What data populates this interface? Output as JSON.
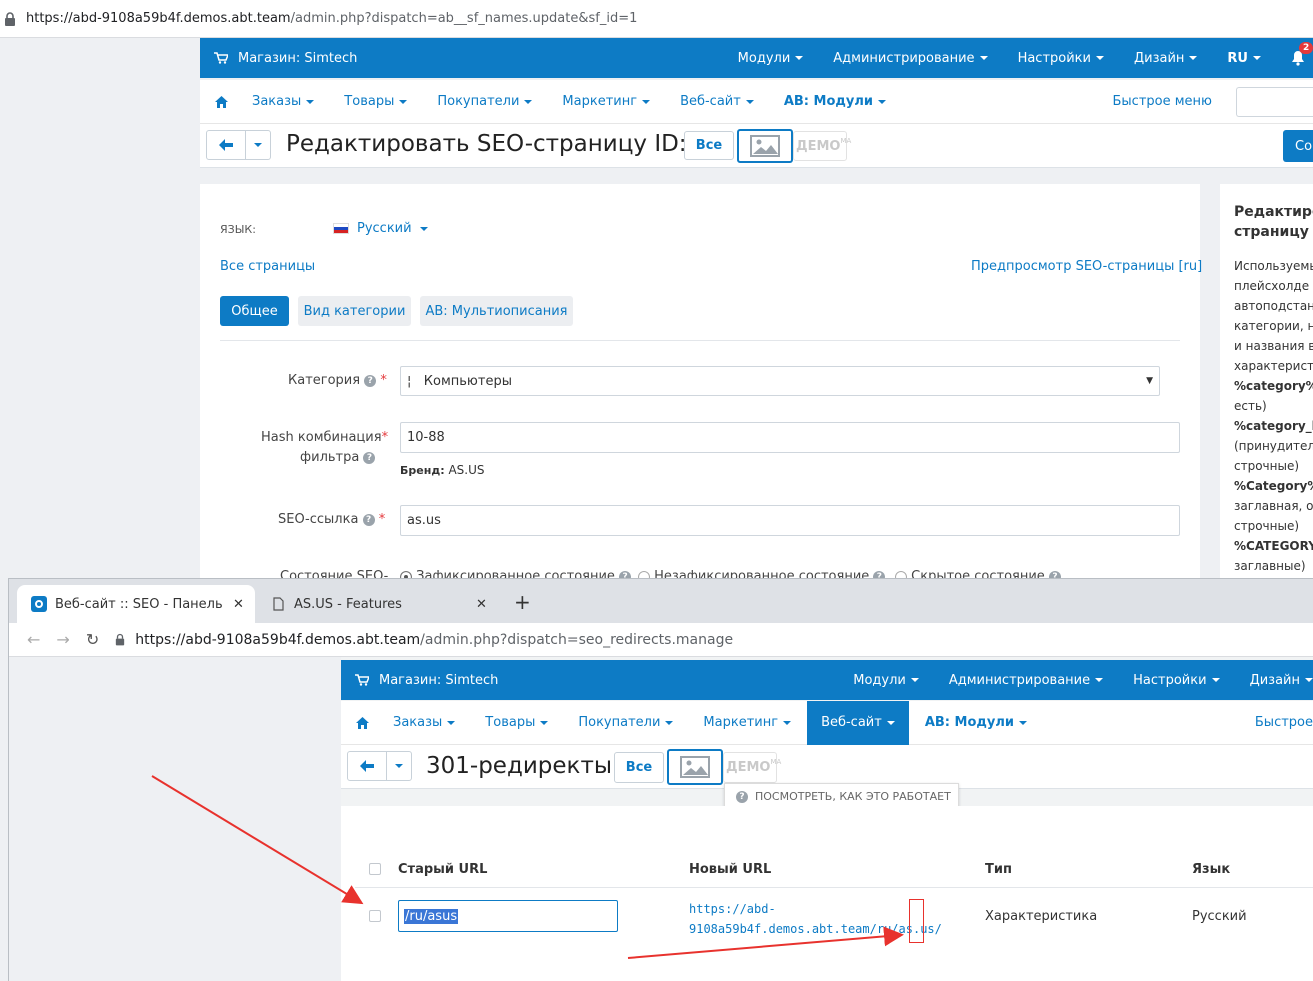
{
  "back_window": {
    "url_host": "https://abd-9108a59b4f.demos.abt.team",
    "url_path": "/admin.php?dispatch=ab__sf_names.update&sf_id=1",
    "store_label": "Магазин: Simtech",
    "top_menu": [
      "Модули",
      "Администрирование",
      "Настройки",
      "Дизайн",
      "RU"
    ],
    "notification_count": "2",
    "secondary_menu": [
      "Заказы",
      "Товары",
      "Покупатели",
      "Маркетинг",
      "Веб-сайт",
      "AB: Модули"
    ],
    "quick_menu": "Быстрое меню",
    "page_title": "Редактировать SEO-страницу ID: 1",
    "all_button": "Все",
    "demo_label": "ДЕМО",
    "demo_suffix": "МА",
    "save_button": "Со",
    "language_label": "ЯЗЫК:",
    "language_value": "Русский",
    "all_pages_link": "Все страницы",
    "preview_link": "Предпросмотр SEO-страницы [ru]",
    "tabs": [
      "Общее",
      "Вид категории",
      "AB: Мультиописания"
    ],
    "category_label": "Категория",
    "category_value": "¦   Компьютеры",
    "hash_label_1": "Hash комбинация",
    "hash_label_2": "фильтра",
    "hash_value": "10-88",
    "brand_key": "Бренд:",
    "brand_value": "AS.US",
    "seo_link_label": "SEO-ссылка",
    "seo_link_value": "as.us",
    "state_label": "Состояние SEO-",
    "state_options": [
      "Зафиксированное состояние",
      "Незафиксированное состояние",
      "Скрытое состояние"
    ],
    "side_title_1": "Редактиро",
    "side_title_2": "страницу I",
    "side_lines": [
      "Используемы",
      "плейсхолде",
      "автоподстан",
      "категории, н",
      "и названия в",
      "характерист"
    ],
    "side_vars": [
      {
        "bold": "%category%",
        "text": " (с"
      },
      {
        "bold": "",
        "text": "есть)"
      },
      {
        "bold": "%category_lov",
        "text": ""
      },
      {
        "bold": "",
        "text": "(принудител"
      },
      {
        "bold": "",
        "text": "строчные)"
      },
      {
        "bold": "%Category%",
        "text": " ("
      },
      {
        "bold": "",
        "text": "заглавная, о"
      },
      {
        "bold": "",
        "text": "строчные)"
      },
      {
        "bold": "%CATEGORY%",
        "text": ""
      },
      {
        "bold": "",
        "text": "заглавные)"
      }
    ]
  },
  "front_window": {
    "tab1_title": "Веб-сайт :: SEO - Панель адм",
    "tab2_title": "AS.US - Features",
    "url_host": "https://abd-9108a59b4f.demos.abt.team",
    "url_path": "/admin.php?dispatch=seo_redirects.manage",
    "store_label": "Магазин: Simtech",
    "top_menu": [
      "Модули",
      "Администрирование",
      "Настройки",
      "Дизайн"
    ],
    "secondary_menu": [
      "Заказы",
      "Товары",
      "Покупатели",
      "Маркетинг",
      "Веб-сайт",
      "AB: Модули"
    ],
    "quick_menu": "Быстрое",
    "page_title": "301-редиректы",
    "all_button": "Все",
    "demo_label": "ДЕМО",
    "demo_suffix": "МА",
    "tooltip": "ПОСМОТРЕТЬ, КАК ЭТО РАБОТАЕТ",
    "columns": [
      "Старый URL",
      "Новый URL",
      "Тип",
      "Язык"
    ],
    "row": {
      "old_url": "/ru/asus",
      "new_url_line1": "https://abd-",
      "new_url_line2": "9108a59b4f.demos.abt.team/ru/as.us/",
      "type": "Характеристика",
      "language": "Русский"
    }
  },
  "colors": {
    "accent": "#0d7bc5",
    "annotation": "#e8322d"
  }
}
